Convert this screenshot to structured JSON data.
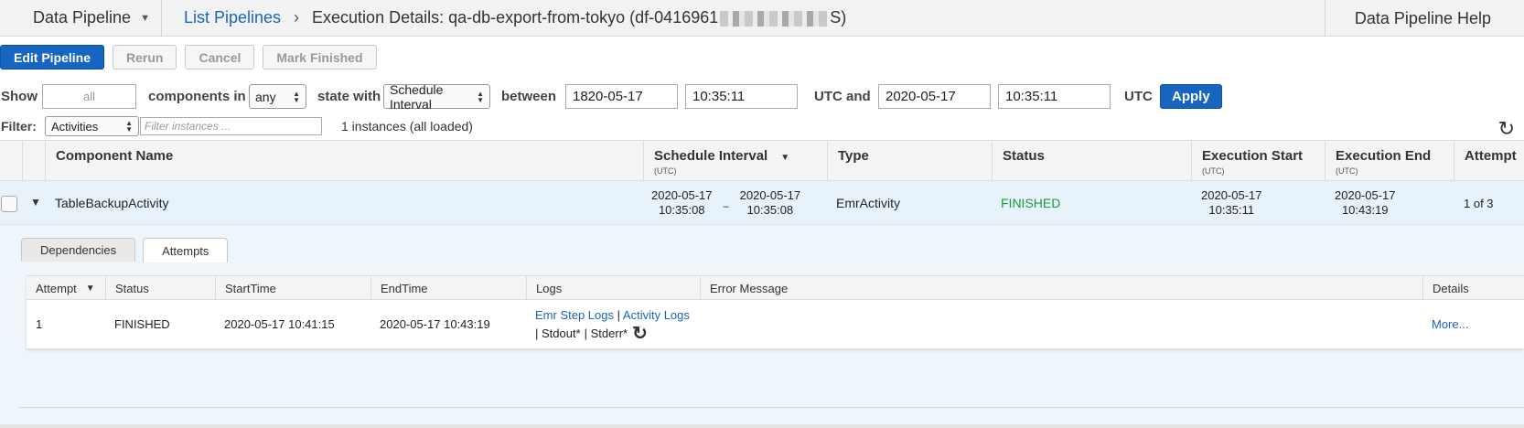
{
  "topbar": {
    "service": "Data Pipeline",
    "breadcrumb_link": "List Pipelines",
    "title_prefix": "Execution Details: qa-db-export-from-tokyo (df-0416961",
    "title_suffix": "S)",
    "help": "Data Pipeline Help"
  },
  "actions": {
    "edit": "Edit Pipeline",
    "rerun": "Rerun",
    "cancel": "Cancel",
    "mark_finished": "Mark Finished"
  },
  "filters": {
    "show_label": "Show",
    "show_placeholder": "all",
    "components_in_label": "components in",
    "components_in_value": "any",
    "state_with_label": "state with",
    "state_with_value": "Schedule Interval",
    "between_label": "between",
    "start_date": "1820-05-17",
    "start_time": "10:35:11",
    "utc_and_label": "UTC and",
    "end_date": "2020-05-17",
    "end_time": "10:35:11",
    "utc_label": "UTC",
    "apply": "Apply",
    "filter_label": "Filter:",
    "filter_type": "Activities",
    "filter_placeholder": "Filter instances ...",
    "instances_count": "1 instances (all loaded)"
  },
  "table": {
    "headers": {
      "component_name": "Component Name",
      "schedule_interval": "Schedule Interval",
      "schedule_interval_unit": "(UTC)",
      "type": "Type",
      "status": "Status",
      "execution_start": "Execution Start",
      "execution_start_unit": "(UTC)",
      "execution_end": "Execution End",
      "execution_end_unit": "(UTC)",
      "attempt": "Attempt"
    },
    "rows": [
      {
        "component_name": "TableBackupActivity",
        "interval_start_date": "2020-05-17",
        "interval_start_time": "10:35:08",
        "interval_dash": "–",
        "interval_end_date": "2020-05-17",
        "interval_end_time": "10:35:08",
        "type": "EmrActivity",
        "status": "FINISHED",
        "exec_start_date": "2020-05-17",
        "exec_start_time": "10:35:11",
        "exec_end_date": "2020-05-17",
        "exec_end_time": "10:43:19",
        "attempt": "1 of 3"
      }
    ]
  },
  "detail": {
    "tabs": [
      "Dependencies",
      "Attempts"
    ],
    "headers": {
      "attempt": "Attempt",
      "status": "Status",
      "start_time": "StartTime",
      "end_time": "EndTime",
      "logs": "Logs",
      "error_message": "Error Message",
      "details": "Details"
    },
    "rows": [
      {
        "attempt": "1",
        "status": "FINISHED",
        "start_time": "2020-05-17 10:41:15",
        "end_time": "2020-05-17 10:43:19",
        "emr_step_logs": "Emr Step Logs",
        "pipe1": "|",
        "activity_logs": "Activity Logs",
        "stdout": "| Stdout*",
        "stderr": "| Stderr*",
        "error_message": "",
        "details": "More..."
      }
    ]
  },
  "colors": {
    "accent": "#1665c1",
    "link": "#1a66b8",
    "status_finished": "#1a9c3a",
    "row_selected": "#e7f2fb"
  }
}
